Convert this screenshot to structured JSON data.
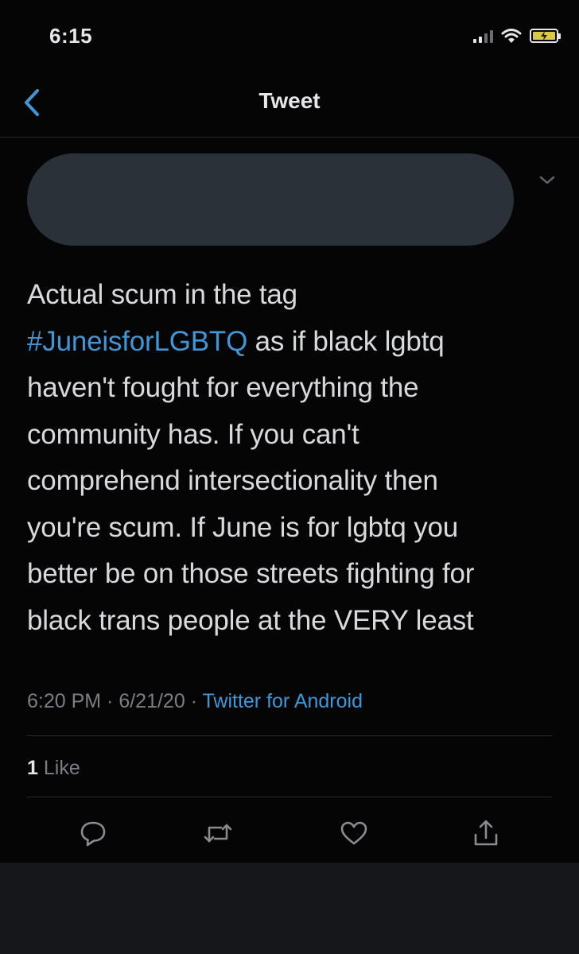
{
  "status_bar": {
    "time": "6:15"
  },
  "nav": {
    "title": "Tweet"
  },
  "tweet": {
    "lines": [
      {
        "text": "Actual scum in the tag"
      },
      {
        "hashtag": "#JuneisforLGBTQ",
        "text": " as if black lgbtq"
      },
      {
        "text": "haven't fought for everything the"
      },
      {
        "text": "community has. If you can't"
      },
      {
        "text": "comprehend intersectionality then"
      },
      {
        "text": "you're scum. If June is for lgbtq you"
      },
      {
        "text": "better be on those streets fighting for"
      },
      {
        "text": "black trans people at the VERY least"
      }
    ],
    "time": "6:20 PM",
    "separator": " · ",
    "date": "6/21/20",
    "source": "Twitter for Android",
    "like_count": "1",
    "like_label": "Like"
  },
  "colors": {
    "background": "#050506",
    "text": "#d8d9dc",
    "accent": "#3f97d8",
    "muted": "#7c7e84",
    "redaction": "#2b3138"
  },
  "icons": {
    "back": "chevron-left-icon",
    "more": "chevron-down-icon",
    "reply": "comment-icon",
    "retweet": "retweet-icon",
    "like": "heart-icon",
    "share": "share-icon"
  }
}
